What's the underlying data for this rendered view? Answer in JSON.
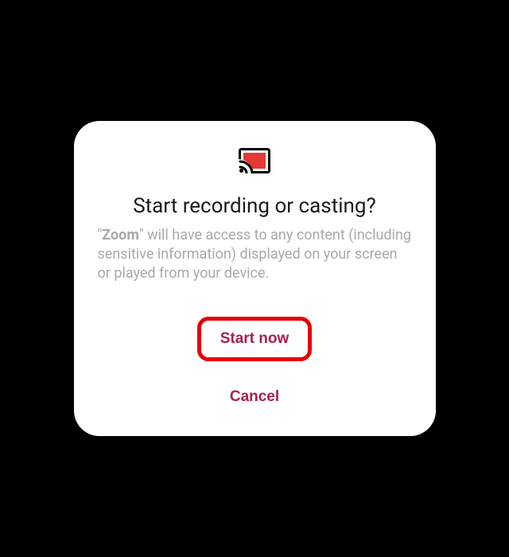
{
  "dialog": {
    "icon": "cast-icon",
    "title": "Start recording or casting?",
    "body": {
      "appname": "Zoom",
      "text": " will have access to any content (including sensitive information) displayed on your screen or played from your device."
    },
    "primary_label": "Start now",
    "cancel_label": "Cancel"
  },
  "colors": {
    "accent": "#a91e52",
    "highlight_border": "#e60000",
    "icon_fill": "#e53935"
  }
}
